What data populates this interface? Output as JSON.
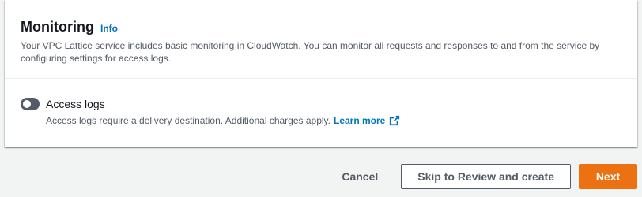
{
  "monitoring": {
    "title": "Monitoring",
    "info_label": "Info",
    "description": "Your VPC Lattice service includes basic monitoring in CloudWatch. You can monitor all requests and responses to and from the service by configuring settings for access logs."
  },
  "access_logs": {
    "label": "Access logs",
    "enabled": false,
    "description": "Access logs require a delivery destination. Additional charges apply.",
    "learn_more_label": "Learn more"
  },
  "actions": {
    "cancel_label": "Cancel",
    "skip_label": "Skip to Review and create",
    "next_label": "Next"
  },
  "colors": {
    "link": "#0073bb",
    "primary": "#ec7211",
    "toggle_off": "#545b64"
  },
  "icons": {
    "external": "external-link-icon"
  }
}
